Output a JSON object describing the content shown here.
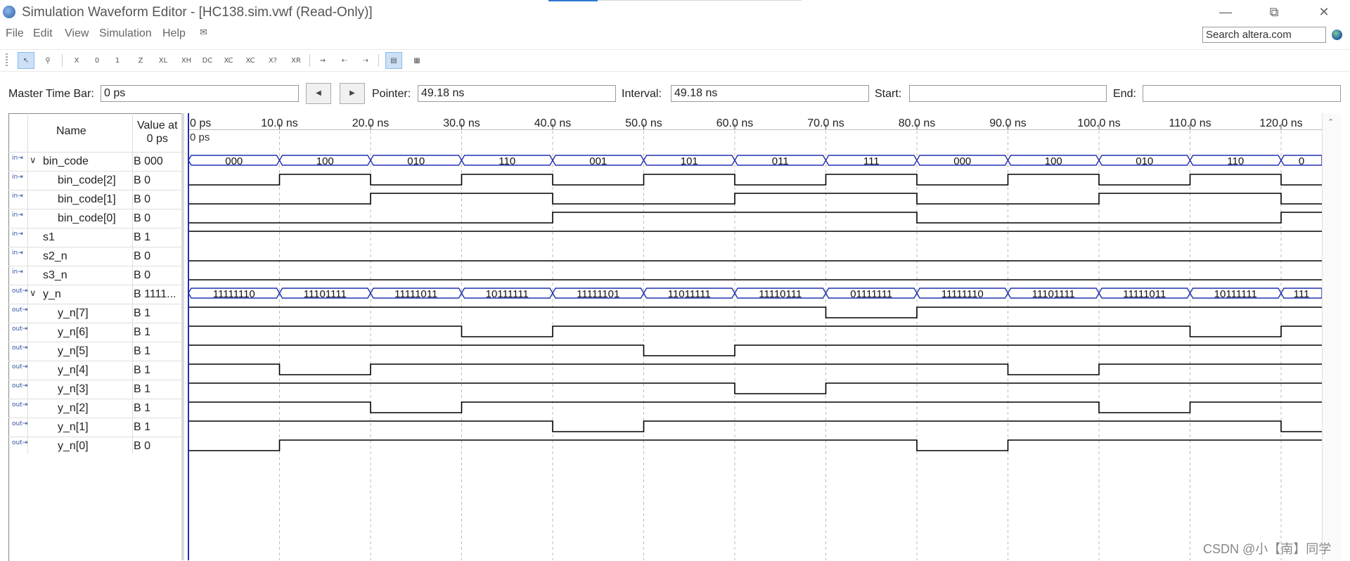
{
  "window": {
    "title": "Simulation Waveform Editor - [HC138.sim.vwf (Read-Only)]",
    "controls": {
      "minimize": "—",
      "restore": "⧉",
      "close": "✕"
    }
  },
  "menu": [
    "File",
    "Edit",
    "View",
    "Simulation",
    "Help"
  ],
  "search": {
    "placeholder": "Search altera.com"
  },
  "toolbar_icons": [
    "selection-tool-icon",
    "zoom-tool-icon",
    "unknown-value-icon",
    "force-low-icon",
    "force-high-icon",
    "high-impedance-icon",
    "weak-low-icon",
    "weak-high-icon",
    "dont-care-icon",
    "invert-icon",
    "count-value-icon",
    "clock-icon",
    "arbitrary-value-icon",
    "random-value-icon",
    "snap-to-grid-icon",
    "previous-transition-icon",
    "next-transition-icon",
    "grid-icon",
    "table-icon"
  ],
  "timebar": {
    "master_label": "Master Time Bar:",
    "master_value": "0 ps",
    "pointer_label": "Pointer:",
    "pointer_value": "49.18 ns",
    "interval_label": "Interval:",
    "interval_value": "49.18 ns",
    "start_label": "Start:",
    "start_value": "",
    "end_label": "End:",
    "end_value": ""
  },
  "grid": {
    "name_header": "Name",
    "value_header_line1": "Value at",
    "value_header_line2": "0 ps"
  },
  "signals": [
    {
      "name": "bin_code",
      "value": "B 000",
      "dir": "in",
      "group": true
    },
    {
      "name": "bin_code[2]",
      "value": "B 0",
      "dir": "in",
      "group": false,
      "child": true
    },
    {
      "name": "bin_code[1]",
      "value": "B 0",
      "dir": "in",
      "group": false,
      "child": true
    },
    {
      "name": "bin_code[0]",
      "value": "B 0",
      "dir": "in",
      "group": false,
      "child": true
    },
    {
      "name": "s1",
      "value": "B 1",
      "dir": "in",
      "group": false
    },
    {
      "name": "s2_n",
      "value": "B 0",
      "dir": "in",
      "group": false
    },
    {
      "name": "s3_n",
      "value": "B 0",
      "dir": "in",
      "group": false
    },
    {
      "name": "y_n",
      "value": "B 1111...",
      "dir": "out",
      "group": true
    },
    {
      "name": "y_n[7]",
      "value": "B 1",
      "dir": "out",
      "group": false,
      "child": true
    },
    {
      "name": "y_n[6]",
      "value": "B 1",
      "dir": "out",
      "group": false,
      "child": true
    },
    {
      "name": "y_n[5]",
      "value": "B 1",
      "dir": "out",
      "group": false,
      "child": true
    },
    {
      "name": "y_n[4]",
      "value": "B 1",
      "dir": "out",
      "group": false,
      "child": true
    },
    {
      "name": "y_n[3]",
      "value": "B 1",
      "dir": "out",
      "group": false,
      "child": true
    },
    {
      "name": "y_n[2]",
      "value": "B 1",
      "dir": "out",
      "group": false,
      "child": true
    },
    {
      "name": "y_n[1]",
      "value": "B 1",
      "dir": "out",
      "group": false,
      "child": true
    },
    {
      "name": "y_n[0]",
      "value": "B 0",
      "dir": "out",
      "group": false,
      "child": true
    }
  ],
  "time_axis": {
    "labels": [
      "0 ps",
      "10.0 ns",
      "20.0 ns",
      "30.0 ns",
      "40.0 ns",
      "50.0 ns",
      "60.0 ns",
      "70.0 ns",
      "80.0 ns",
      "90.0 ns",
      "100.0 ns",
      "110.0 ns",
      "120.0 ns"
    ],
    "cursor_label": "0 ps",
    "visible_end_ns": 124.5
  },
  "waveforms": {
    "period_ns": 10,
    "bin_code_bus": [
      "000",
      "100",
      "010",
      "110",
      "001",
      "101",
      "011",
      "111",
      "000",
      "100",
      "010",
      "110",
      "0"
    ],
    "y_n_bus": [
      "11111110",
      "11101111",
      "11111011",
      "10111111",
      "11111101",
      "11011111",
      "11110111",
      "01111111",
      "11111110",
      "11101111",
      "11111011",
      "10111111",
      "111"
    ],
    "bin_code_bits": {
      "bin_code[2]": [
        0,
        1,
        0,
        1,
        0,
        1,
        0,
        1,
        0,
        1,
        0,
        1,
        0
      ],
      "bin_code[1]": [
        0,
        0,
        1,
        1,
        0,
        0,
        1,
        1,
        0,
        0,
        1,
        1,
        0
      ],
      "bin_code[0]": [
        0,
        0,
        0,
        0,
        1,
        1,
        1,
        1,
        0,
        0,
        0,
        0,
        1
      ]
    },
    "constant": {
      "s1": 1,
      "s2_n": 0,
      "s3_n": 0
    },
    "y_n_bits": {
      "y_n[7]": [
        1,
        1,
        1,
        1,
        1,
        1,
        1,
        0,
        1,
        1,
        1,
        1,
        1
      ],
      "y_n[6]": [
        1,
        1,
        1,
        0,
        1,
        1,
        1,
        1,
        1,
        1,
        1,
        0,
        1
      ],
      "y_n[5]": [
        1,
        1,
        1,
        1,
        1,
        0,
        1,
        1,
        1,
        1,
        1,
        1,
        1
      ],
      "y_n[4]": [
        1,
        0,
        1,
        1,
        1,
        1,
        1,
        1,
        1,
        0,
        1,
        1,
        1
      ],
      "y_n[3]": [
        1,
        1,
        1,
        1,
        1,
        1,
        0,
        1,
        1,
        1,
        1,
        1,
        1
      ],
      "y_n[2]": [
        1,
        1,
        0,
        1,
        1,
        1,
        1,
        1,
        1,
        1,
        0,
        1,
        1
      ],
      "y_n[1]": [
        1,
        1,
        1,
        1,
        0,
        1,
        1,
        1,
        1,
        1,
        1,
        1,
        0
      ],
      "y_n[0]": [
        0,
        1,
        1,
        1,
        1,
        1,
        1,
        1,
        0,
        1,
        1,
        1,
        1
      ]
    }
  },
  "colors": {
    "bus_outline": "#2030b0",
    "wave": "#000000",
    "cursor": "#2030b0",
    "grid_dash": "#bbbbbb",
    "selected_tool": "#cce0f7"
  },
  "watermark": "CSDN @小【南】同学"
}
